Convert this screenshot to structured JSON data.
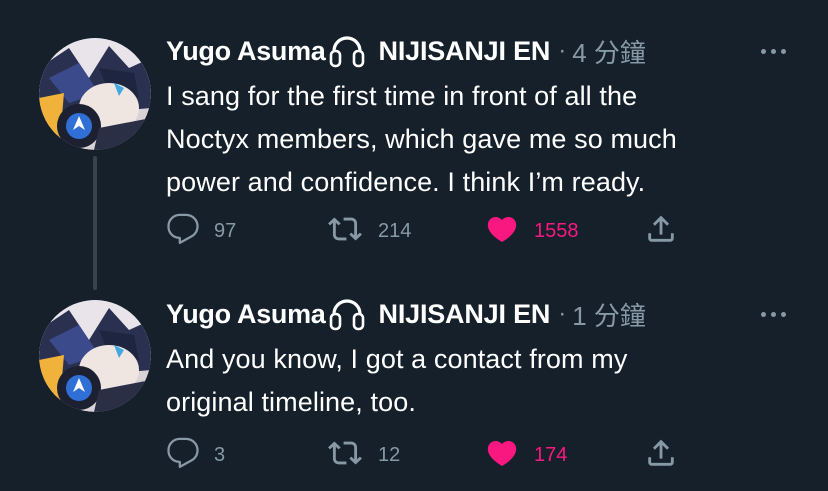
{
  "tweets": [
    {
      "display_name": "Yugo Asuma",
      "affiliation": "NIJISANJI EN",
      "separator": "·",
      "time": "4 分鐘",
      "text_lines": [
        "I sang for the first time in front of all the",
        "Noctyx members, which gave me so much",
        "power and confidence. I think I’m ready."
      ],
      "replies": "97",
      "retweets": "214",
      "likes": "1558",
      "liked": true
    },
    {
      "display_name": "Yugo Asuma",
      "affiliation": "NIJISANJI EN",
      "separator": "·",
      "time": "1 分鐘",
      "text_lines": [
        "And you know, I got a contact from my",
        "original timeline, too."
      ],
      "replies": "3",
      "retweets": "12",
      "likes": "174",
      "liked": true
    }
  ],
  "colors": {
    "background": "#15202b",
    "text": "#ffffff",
    "muted": "#8899a6",
    "like": "#f91880",
    "thread_line": "#38444d"
  },
  "icons": {
    "reply": "reply-bubble-icon",
    "retweet": "retweet-icon",
    "like": "heart-icon",
    "share": "share-icon",
    "more": "more-dots-icon",
    "headphones": "headphones-icon"
  }
}
